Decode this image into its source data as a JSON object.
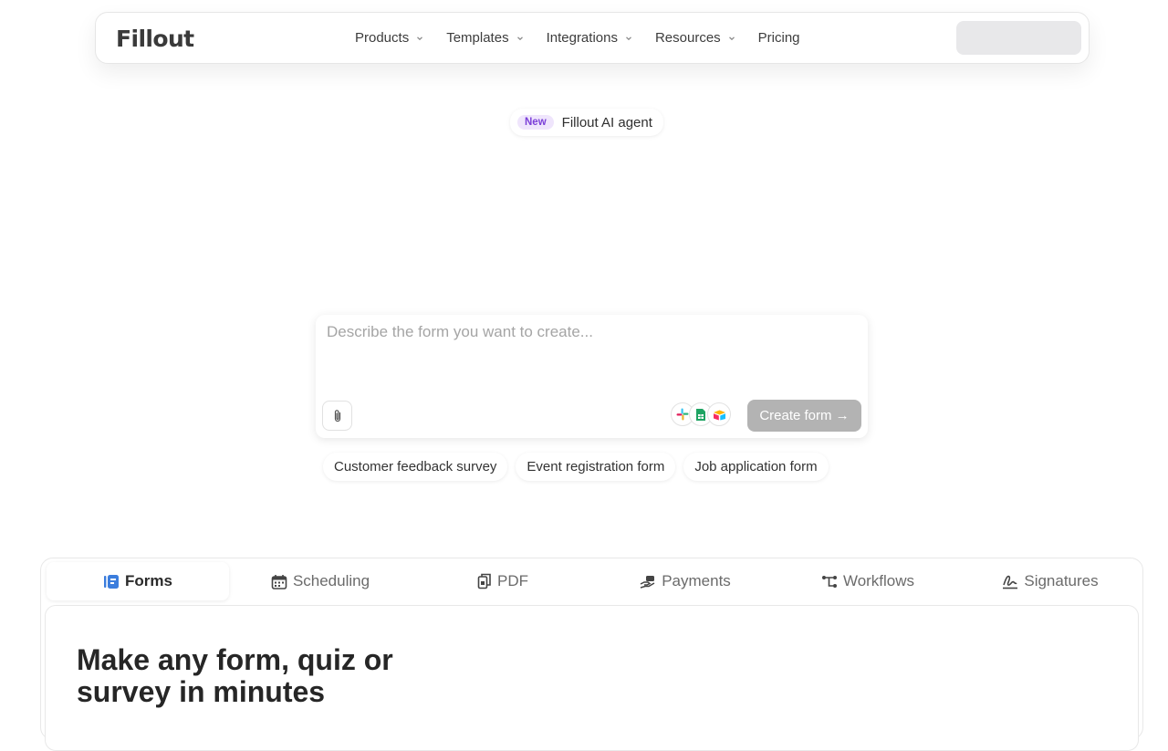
{
  "nav": {
    "logo": "Fillout",
    "menu": [
      {
        "label": "Products",
        "has_dropdown": true
      },
      {
        "label": "Templates",
        "has_dropdown": true
      },
      {
        "label": "Integrations",
        "has_dropdown": true
      },
      {
        "label": "Resources",
        "has_dropdown": true
      },
      {
        "label": "Pricing",
        "has_dropdown": false
      }
    ]
  },
  "badge": {
    "tag": "New",
    "text": "Fillout AI agent"
  },
  "prompt": {
    "placeholder": "Describe the form you want to create...",
    "value": "",
    "integration_icons": [
      "slack-icon",
      "google-sheets-icon",
      "airtable-icon"
    ],
    "create_label": "Create form →"
  },
  "chips": [
    "Customer feedback survey",
    "Event registration form",
    "Job application form"
  ],
  "tabs": [
    {
      "label": "Forms",
      "icon": "forms-icon",
      "active": true
    },
    {
      "label": "Scheduling",
      "icon": "calendar-icon",
      "active": false
    },
    {
      "label": "PDF",
      "icon": "pdf-icon",
      "active": false
    },
    {
      "label": "Payments",
      "icon": "payments-icon",
      "active": false
    },
    {
      "label": "Workflows",
      "icon": "workflows-icon",
      "active": false
    },
    {
      "label": "Signatures",
      "icon": "signature-icon",
      "active": false
    }
  ],
  "feature": {
    "headline": "Make any form, quiz or survey in minutes"
  },
  "colors": {
    "accent_blue": "#3b7ddd",
    "badge_purple": "#7b3fd8",
    "disabled_button": "#b3b3b3"
  }
}
